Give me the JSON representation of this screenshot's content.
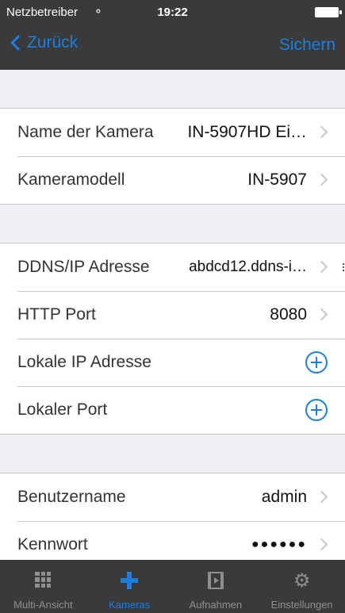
{
  "status_bar": {
    "carrier": "Netzbetreiber",
    "time": "19:22"
  },
  "nav": {
    "back_label": "Zurück",
    "save_label": "Sichern"
  },
  "groups": [
    {
      "rows": [
        {
          "label": "Name der Kamera",
          "value": "IN-5907HD Ei…"
        },
        {
          "label": "Kameramodell",
          "value": "IN-5907"
        }
      ]
    },
    {
      "rows": [
        {
          "label": "DDNS/IP Adresse",
          "value": "abdcd12.ddns-i…"
        },
        {
          "label": "HTTP Port",
          "value": "8080"
        },
        {
          "label": "Lokale IP Adresse",
          "value": ""
        },
        {
          "label": "Lokaler Port",
          "value": ""
        }
      ]
    },
    {
      "rows": [
        {
          "label": "Benutzername",
          "value": "admin"
        },
        {
          "label": "Kennwort",
          "value": "●●●●●●"
        }
      ]
    }
  ],
  "tabs": [
    {
      "label": "Multi-Ansicht",
      "icon": "grid-icon"
    },
    {
      "label": "Kameras",
      "icon": "plus-icon",
      "active": true
    },
    {
      "label": "Aufnahmen",
      "icon": "film-icon"
    },
    {
      "label": "Einstellungen",
      "icon": "gear-icon"
    }
  ],
  "colors": {
    "accent": "#1a7fe0",
    "bar": "#3a3a3a",
    "background": "#efeff4"
  }
}
